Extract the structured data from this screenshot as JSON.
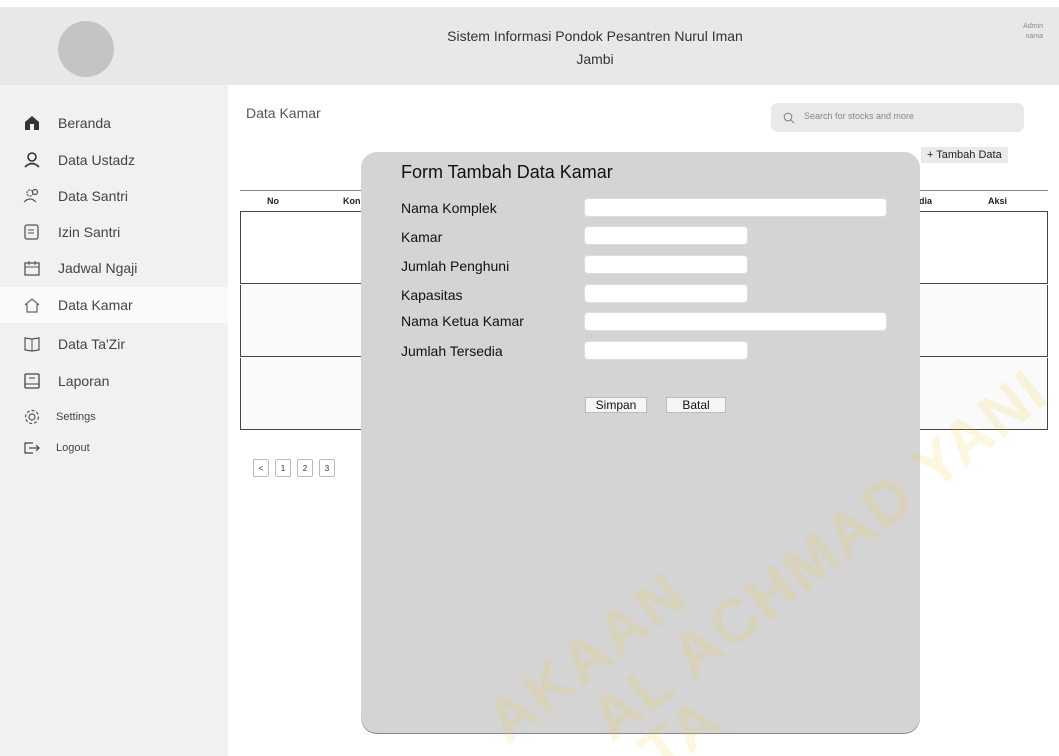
{
  "header": {
    "title": "Sistem Informasi Pondok Pesantren Nurul Iman Jambi",
    "admin_line1": "Admin",
    "admin_line2": "nama"
  },
  "sidebar": {
    "items": [
      {
        "label": "Beranda",
        "icon": "home-icon",
        "active": false
      },
      {
        "label": "Data Ustadz",
        "icon": "user-icon",
        "active": false
      },
      {
        "label": "Data Santri",
        "icon": "users-icon",
        "active": false
      },
      {
        "label": "Izin Santri",
        "icon": "document-icon",
        "active": false
      },
      {
        "label": "Jadwal Ngaji",
        "icon": "calendar-icon",
        "active": false
      },
      {
        "label": "Data Kamar",
        "icon": "house-icon",
        "active": true
      },
      {
        "label": "Data Ta'Zir",
        "icon": "book-icon",
        "active": false
      },
      {
        "label": "Laporan",
        "icon": "report-icon",
        "active": false
      },
      {
        "label": "Settings",
        "icon": "gear-icon",
        "active": false
      },
      {
        "label": "Logout",
        "icon": "logout-icon",
        "active": false
      }
    ]
  },
  "main": {
    "page_title": "Data Kamar",
    "search_placeholder": "Search for stocks and more",
    "add_button": "+ Tambah Data",
    "table": {
      "columns": [
        "No",
        "Kon",
        "dia",
        "Aksi"
      ]
    },
    "pagination": [
      "<",
      "1",
      "2",
      "3"
    ]
  },
  "modal": {
    "title": "Form Tambah Data Kamar",
    "fields": [
      {
        "label": "Nama Komplek",
        "value": ""
      },
      {
        "label": "Kamar",
        "value": ""
      },
      {
        "label": "Jumlah Penghuni",
        "value": ""
      },
      {
        "label": "Kapasitas",
        "value": ""
      },
      {
        "label": "Nama Ketua Kamar",
        "value": ""
      },
      {
        "label": "Jumlah Tersedia",
        "value": ""
      }
    ],
    "save_label": "Simpan",
    "cancel_label": "Batal"
  },
  "watermark": {
    "line1": "AKAAN",
    "line2": "AL ACHMAD YANI",
    "line3": "TA"
  },
  "colors": {
    "header_bg": "#e8e8e8",
    "sidebar_bg": "#f1f1f1",
    "modal_bg": "#d4d4d4",
    "watermark": "#f0c81e"
  }
}
